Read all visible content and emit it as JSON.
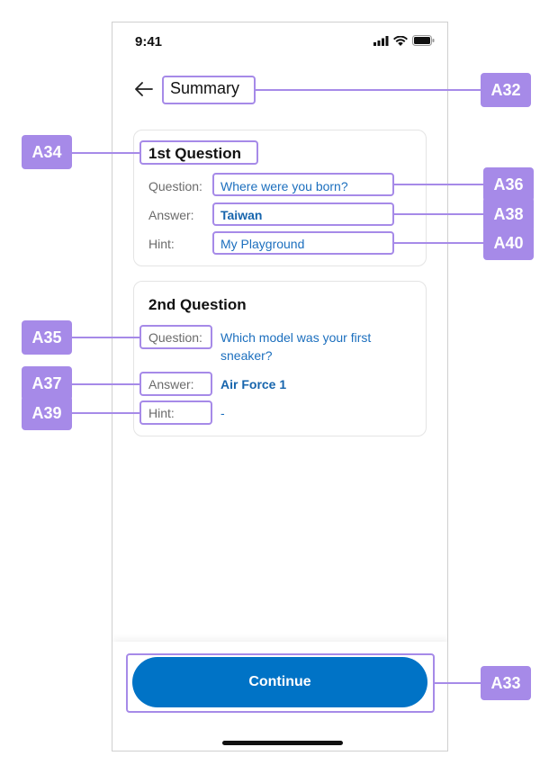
{
  "status_bar": {
    "time": "9:41"
  },
  "header": {
    "title": "Summary"
  },
  "cards": [
    {
      "heading": "1st Question",
      "rows": [
        {
          "label": "Question:",
          "value": "Where were you born?"
        },
        {
          "label": "Answer:",
          "value": "Taiwan"
        },
        {
          "label": "Hint:",
          "value": "My Playground"
        }
      ]
    },
    {
      "heading": "2nd Question",
      "rows": [
        {
          "label": "Question:",
          "value_line1": "Which model  was your first",
          "value_line2": "sneaker?"
        },
        {
          "label": "Answer:",
          "value": "Air Force 1"
        },
        {
          "label": "Hint:",
          "value": "-"
        }
      ]
    }
  ],
  "footer": {
    "continue_label": "Continue"
  },
  "annotations": {
    "a32": "A32",
    "a33": "A33",
    "a34": "A34",
    "a35": "A35",
    "a36": "A36",
    "a37": "A37",
    "a38": "A38",
    "a39": "A39",
    "a40": "A40"
  },
  "colors": {
    "accent": "#0073c6",
    "annotation": "#a68ae8",
    "value_text": "#1c6fbe"
  }
}
